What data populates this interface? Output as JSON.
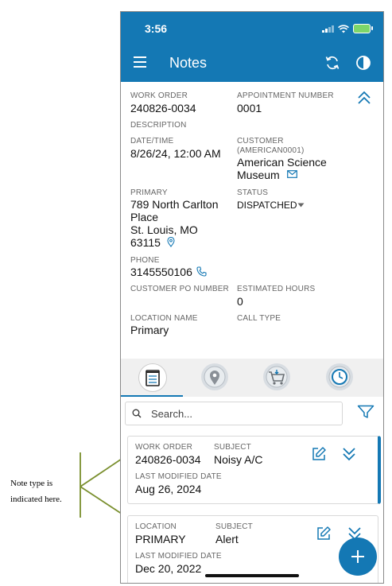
{
  "status_bar": {
    "time": "3:56"
  },
  "app_bar": {
    "title": "Notes"
  },
  "details": {
    "work_order_label": "WORK ORDER",
    "work_order": "240826-0034",
    "appointment_label": "APPOINTMENT NUMBER",
    "appointment": "0001",
    "description_label": "DESCRIPTION",
    "datetime_label": "DATE/TIME",
    "datetime": "8/26/24, 12:00 AM",
    "customer_label_1": "CUSTOMER",
    "customer_label_2": "(AMERICAN0001)",
    "customer_line1": "American Science",
    "customer_line2": "Museum",
    "primary_label": "PRIMARY",
    "address_line1": "789 North Carlton",
    "address_line2": "Place",
    "address_line3": "St. Louis, MO",
    "address_line4": "63115",
    "status_label": "STATUS",
    "status": "DISPATCHED",
    "phone_label": "PHONE",
    "phone": "3145550106",
    "po_label": "CUSTOMER PO NUMBER",
    "hours_label": "ESTIMATED HOURS",
    "hours": "0",
    "location_label": "LOCATION NAME",
    "location": "Primary",
    "call_type_label": "CALL TYPE"
  },
  "tabs": [
    {
      "icon": "notepad-icon",
      "active": true
    },
    {
      "icon": "map-pin-icon"
    },
    {
      "icon": "shopping-cart-icon"
    },
    {
      "icon": "clock-icon"
    }
  ],
  "search": {
    "placeholder": "Search..."
  },
  "notes": [
    {
      "type_label": "WORK ORDER",
      "type_value": "240826-0034",
      "subject_label": "SUBJECT",
      "subject": "Noisy A/C",
      "modified_label": "LAST MODIFIED DATE",
      "modified": "Aug 26, 2024"
    },
    {
      "type_label": "LOCATION",
      "type_value": "PRIMARY",
      "subject_label": "SUBJECT",
      "subject": "Alert",
      "modified_label": "LAST MODIFIED DATE",
      "modified": "Dec 20, 2022"
    }
  ],
  "annotation": {
    "line1": "Note type is",
    "line2": "indicated here."
  },
  "colors": {
    "primary": "#1478b4",
    "annotation_line": "#7a8f2e"
  }
}
